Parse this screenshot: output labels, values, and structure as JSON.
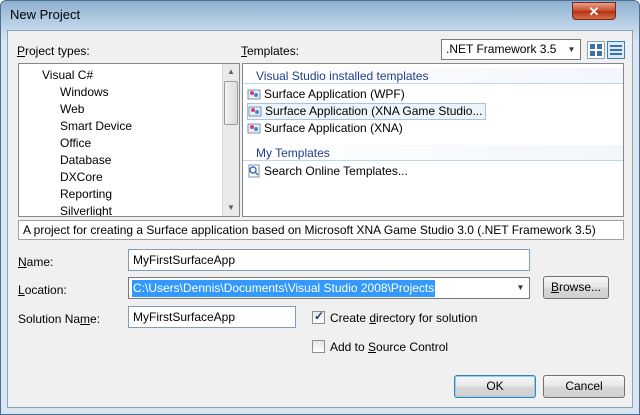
{
  "window": {
    "title": "New Project",
    "close_glyph": "✕"
  },
  "project_types": {
    "label": "Project types:",
    "items": [
      "Visual C#",
      "Windows",
      "Web",
      "Smart Device",
      "Office",
      "Database",
      "DXCore",
      "Reporting",
      "Silverlight"
    ]
  },
  "templates": {
    "label": "Templates:",
    "framework_selected": ".NET Framework 3.5",
    "installed_header": "Visual Studio installed templates",
    "installed": [
      "Surface Application (WPF)",
      "Surface Application (XNA Game Studio...",
      "Surface Application (XNA)"
    ],
    "my_header": "My Templates",
    "my": [
      "Search Online Templates..."
    ]
  },
  "description": "A project for creating a Surface application based on Microsoft XNA Game Studio 3.0 (.NET Framework 3.5)",
  "form": {
    "name_label": "Name:",
    "name_value": "MyFirstSurfaceApp",
    "location_label": "Location:",
    "location_value": "C:\\Users\\Dennis\\Documents\\Visual Studio 2008\\Projects",
    "browse_label": "Browse...",
    "solution_label": "Solution Name:",
    "solution_value": "MyFirstSurfaceApp",
    "create_dir_label": "Create directory for solution",
    "create_dir_checked": true,
    "source_control_label": "Add to Source Control",
    "source_control_checked": false
  },
  "buttons": {
    "ok": "OK",
    "cancel": "Cancel"
  },
  "icons": {
    "check": "✓",
    "dropdown": "▼",
    "scroll_up": "▲",
    "scroll_down": "▼"
  }
}
